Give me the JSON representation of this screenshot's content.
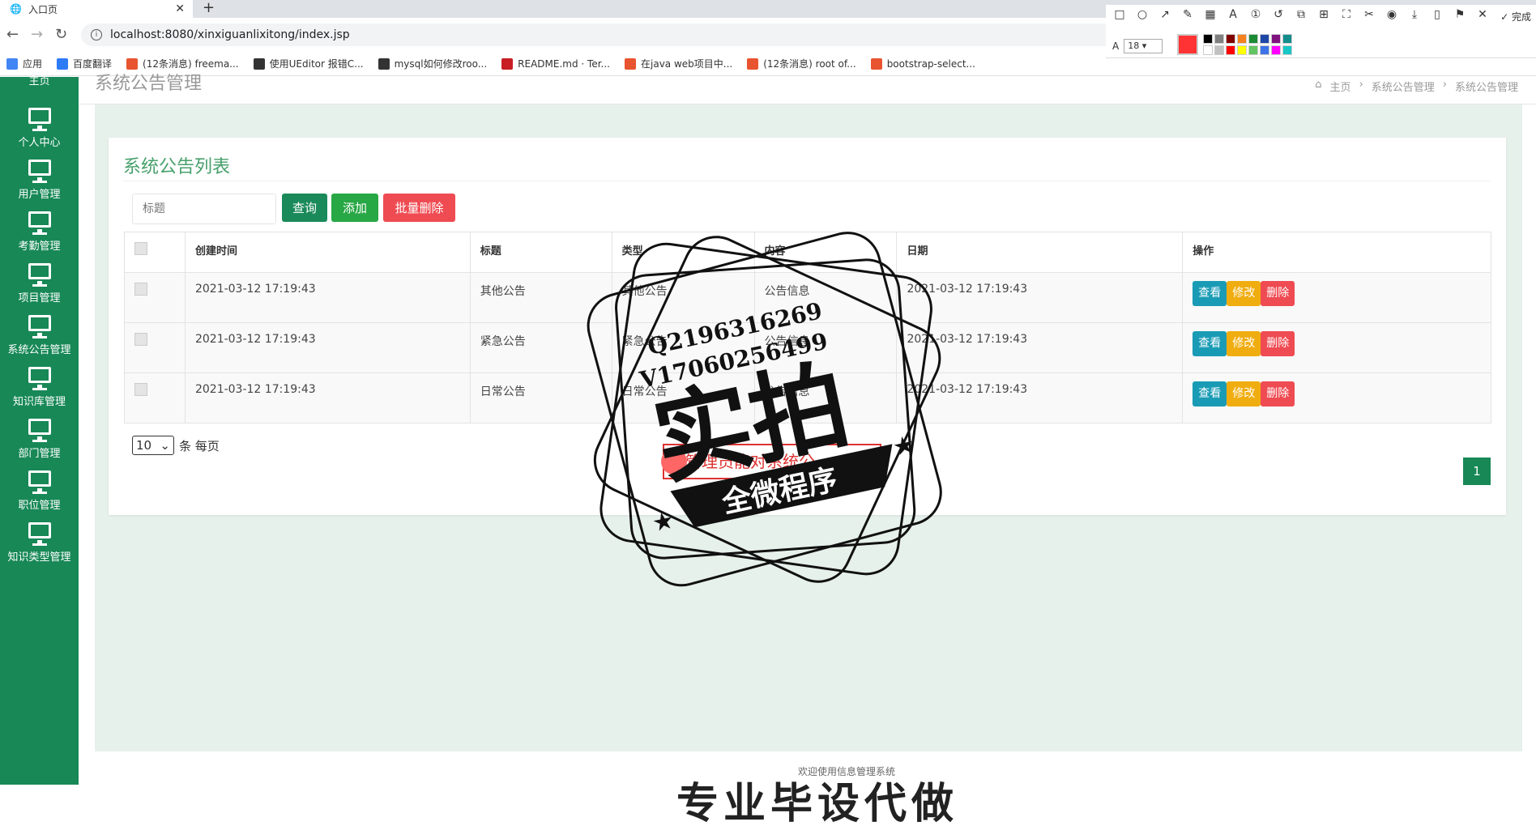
{
  "browser": {
    "tab_title": "入口页",
    "new_tab_label": "+",
    "url": "localhost:8080/xinxiguanlixitong/index.jsp",
    "bookmarks": [
      {
        "label": "应用",
        "color": "#4285f4"
      },
      {
        "label": "百度翻译",
        "color": "#2e7bf6"
      },
      {
        "label": "(12条消息) freema...",
        "color": "#e8542f"
      },
      {
        "label": "使用UEditor 报错C...",
        "color": "#333333"
      },
      {
        "label": "mysql如何修改roo...",
        "color": "#333333"
      },
      {
        "label": "README.md · Ter...",
        "color": "#c71d23"
      },
      {
        "label": "在java web项目中...",
        "color": "#e8542f"
      },
      {
        "label": "(12条消息) root of...",
        "color": "#e8542f"
      },
      {
        "label": "bootstrap-select...",
        "color": "#e8542f"
      }
    ]
  },
  "screenshot_tool": {
    "done_label": "完成",
    "font_size": "18",
    "current_color": "#ff3333",
    "palette": [
      "#000000",
      "#808080",
      "#800000",
      "#f5811f",
      "#1a8a34",
      "#1e47a8",
      "#7f137f",
      "#138c8c",
      "#ffffff",
      "#c0c0c0",
      "#ff0000",
      "#ffff00",
      "#62c462",
      "#3d73e6",
      "#ff00ff",
      "#19c6c6"
    ]
  },
  "sidebar": {
    "items": [
      {
        "label": "主页"
      },
      {
        "label": "个人中心"
      },
      {
        "label": "用户管理"
      },
      {
        "label": "考勤管理"
      },
      {
        "label": "项目管理"
      },
      {
        "label": "系统公告管理"
      },
      {
        "label": "知识库管理"
      },
      {
        "label": "部门管理"
      },
      {
        "label": "职位管理"
      },
      {
        "label": "知识类型管理"
      }
    ]
  },
  "header": {
    "title": "系统公告管理",
    "breadcrumb": [
      "主页",
      "系统公告管理",
      "系统公告管理"
    ]
  },
  "panel": {
    "title": "系统公告列表",
    "search_placeholder": "标题",
    "search_label": "查询",
    "add_label": "添加",
    "batch_delete_label": "批量删除"
  },
  "table": {
    "columns": [
      "",
      "创建时间",
      "标题",
      "类型",
      "内容",
      "日期",
      "操作"
    ],
    "rows": [
      {
        "created": "2021-03-12 17:19:43",
        "title": "其他公告",
        "type": "其他公告",
        "content": "公告信息",
        "date": "2021-03-12 17:19:43"
      },
      {
        "created": "2021-03-12 17:19:43",
        "title": "紧急公告",
        "type": "紧急公告",
        "content": "公告信息",
        "date": "2021-03-12 17:19:43"
      },
      {
        "created": "2021-03-12 17:19:43",
        "title": "日常公告",
        "type": "日常公告",
        "content": "公告信息",
        "date": "2021-03-12 17:19:43"
      }
    ],
    "actions": {
      "view": "查看",
      "edit": "修改",
      "delete": "删除"
    }
  },
  "pagination": {
    "page_size": "10",
    "page_size_suffix": "条 每页",
    "current_page": "1"
  },
  "footer": {
    "text": "欢迎使用信息管理系统",
    "big_text": "专业毕设代做"
  },
  "stamp": {
    "qq": "Q2196316269",
    "vx": "V17060256499",
    "main": "实拍",
    "banner": "全微程序",
    "hint": "管理员能对系统公..."
  }
}
